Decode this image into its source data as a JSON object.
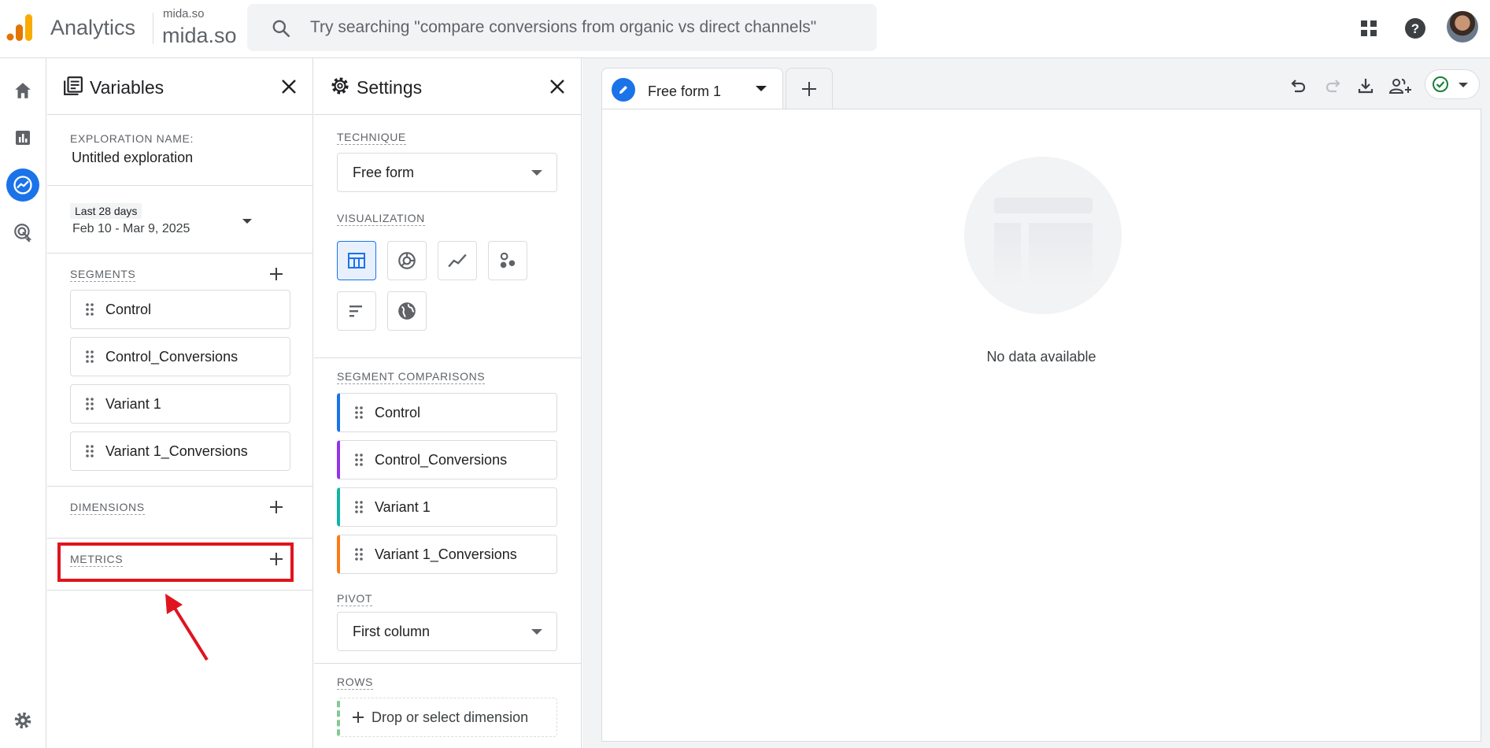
{
  "topbar": {
    "app_name": "Analytics",
    "account_small": "mida.so",
    "account_big": "mida.so",
    "search_placeholder": "Try searching \"compare conversions from organic vs direct channels\"",
    "icons": [
      "apps-grid-icon",
      "help-icon"
    ],
    "brand_colors": {
      "orange": "#f9ab00",
      "dark_orange": "#e37400"
    }
  },
  "rail": {
    "items": [
      "home-icon",
      "reports-icon",
      "explore-icon",
      "advertising-icon",
      "admin-gear-icon"
    ],
    "active": "explore-icon",
    "active_color": "#1a73e8"
  },
  "variables": {
    "title": "Variables",
    "exploration_name_label": "EXPLORATION NAME:",
    "exploration_name": "Untitled exploration",
    "date_badge": "Last 28 days",
    "date_range": "Feb 10 - Mar 9, 2025",
    "segments_label": "SEGMENTS",
    "segments": [
      "Control",
      "Control_Conversions",
      "Variant 1",
      "Variant 1_Conversions"
    ],
    "dimensions_label": "DIMENSIONS",
    "metrics_label": "METRICS"
  },
  "settings": {
    "title": "Settings",
    "technique_label": "TECHNIQUE",
    "technique_value": "Free form",
    "visualization_label": "VISUALIZATION",
    "visualizations": [
      "table-icon",
      "donut-chart-icon",
      "line-chart-icon",
      "scatter-plot-icon",
      "bar-chart-icon",
      "geo-map-icon"
    ],
    "segment_comparisons_label": "SEGMENT COMPARISONS",
    "segment_comparisons": [
      {
        "label": "Control",
        "color": "#1a73e8"
      },
      {
        "label": "Control_Conversions",
        "color": "#9334e6"
      },
      {
        "label": "Variant 1",
        "color": "#12b5a5"
      },
      {
        "label": "Variant 1_Conversions",
        "color": "#fa7b17"
      }
    ],
    "pivot_label": "PIVOT",
    "pivot_value": "First column",
    "rows_label": "ROWS",
    "rows_drop": "Drop or select dimension"
  },
  "canvas": {
    "tab_label": "Free form 1",
    "empty_text": "No data available",
    "toolbar": [
      "undo-icon",
      "redo-icon",
      "download-icon",
      "share-icon",
      "check-status-icon"
    ],
    "status_color": "#188038"
  },
  "annotation": {
    "highlight_color": "#e0141e"
  }
}
